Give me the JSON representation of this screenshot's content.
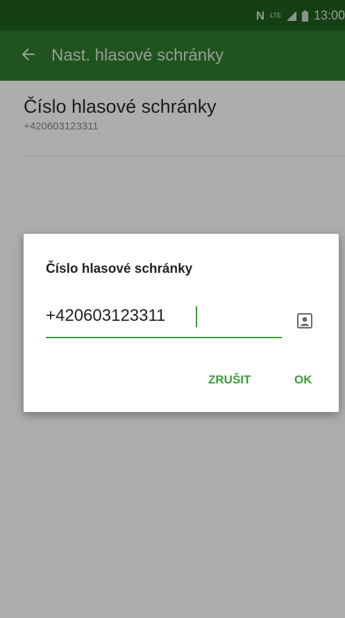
{
  "status_bar": {
    "nfc_symbol": "N",
    "network_label": "LTE",
    "time": "13:00"
  },
  "app_bar": {
    "title": "Nast. hlasové schránky",
    "back_icon": "arrow-left-icon"
  },
  "setting": {
    "title": "Číslo hlasové schránky",
    "value": "+420603123311"
  },
  "dialog": {
    "title": "Číslo hlasové schránky",
    "input_value": "+420603123311",
    "contact_icon": "contact-card-icon",
    "cancel_label": "ZRUŠIT",
    "ok_label": "OK"
  },
  "colors": {
    "status_bar": "#1f5f1f",
    "app_bar": "#2e7d2e",
    "accent": "#3c9a3c"
  }
}
